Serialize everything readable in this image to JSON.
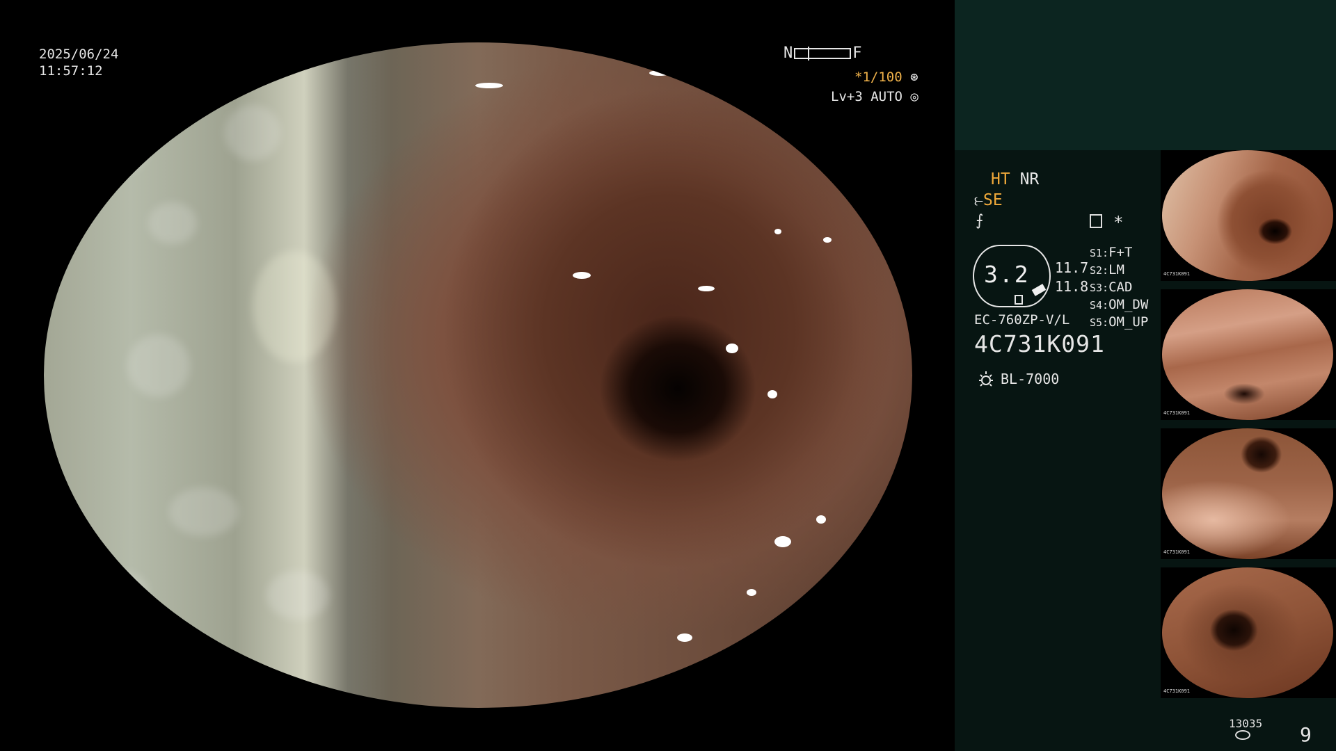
{
  "scope_overlay": {
    "date": "2025/06/24",
    "time": "11:57:12",
    "nf_left": "N",
    "nf_right": "F",
    "shutter": "*1/100",
    "shutter_icon": "aperture-icon",
    "level": "Lv+3 AUTO",
    "auto_icon": "auto-iris-icon"
  },
  "panel": {
    "ht": "HT",
    "nr": "NR",
    "se": "SE",
    "se_icon": "structure-enhance-icon",
    "f_icon": "filter-icon",
    "indicator_icon": "memory-card-icon",
    "star": "*",
    "zoom": "3.2",
    "zoom_sub1": "11.7",
    "zoom_sub2": "11.8",
    "switches": [
      {
        "key": "S1:",
        "value": "F+T"
      },
      {
        "key": "S2:",
        "value": "LM"
      },
      {
        "key": "S3:",
        "value": "CAD"
      },
      {
        "key": "S4:",
        "value": "OM_DW"
      },
      {
        "key": "S5:",
        "value": "OM_UP"
      }
    ],
    "scope_model": "EC-760ZP-V/L",
    "serial": "4C731K091",
    "light_icon": "light-source-icon",
    "light_source": "BL-7000",
    "capture_count": "13035",
    "page_number": "9"
  },
  "colors": {
    "accent": "#f0a93a",
    "panel_bg": "#071512",
    "panel_top_bg": "#0c2520"
  }
}
